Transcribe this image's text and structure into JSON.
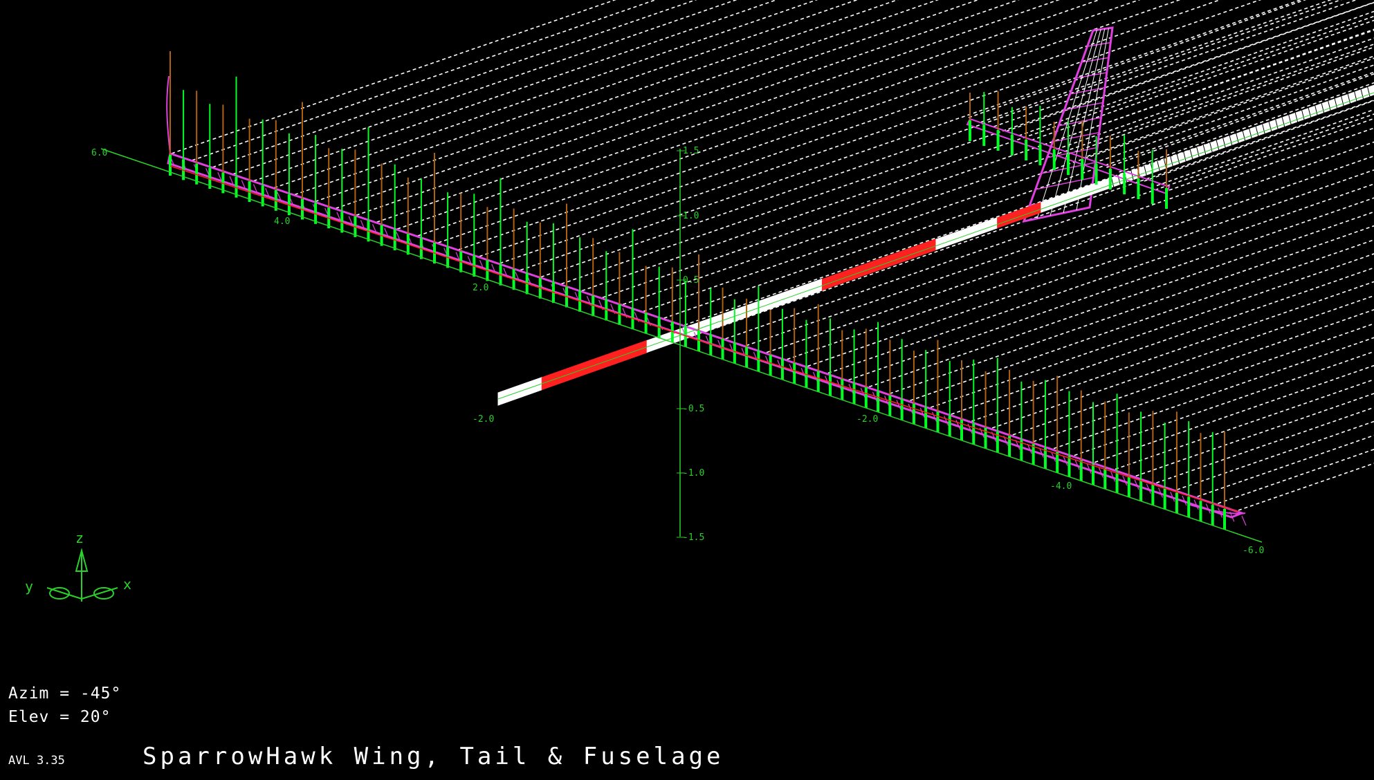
{
  "app": "AVL 3.35",
  "title": "SparrowHawk Wing, Tail & Fuselage",
  "view": {
    "azim": "Azim = -45°",
    "elev": "Elev = 20°"
  },
  "axis_triad": {
    "z": "z",
    "y": "y",
    "x": "x"
  },
  "axis_ticks": {
    "y_axis": [
      "6.0",
      "4.0",
      "2.0",
      "-2.0",
      "-4.0",
      "-6.0"
    ],
    "x_axis": [
      "-2.0"
    ],
    "z_axis": [
      "1.5",
      "1.0",
      "0.5",
      "-0.5",
      "-1.0",
      "-1.5"
    ]
  },
  "colors": {
    "background": "#000000",
    "axes": "#2bd12b",
    "wake": "#ffffff",
    "panels": "#e040e0",
    "load_vectors": "#00ff22",
    "fuselage": "#ff2020"
  }
}
